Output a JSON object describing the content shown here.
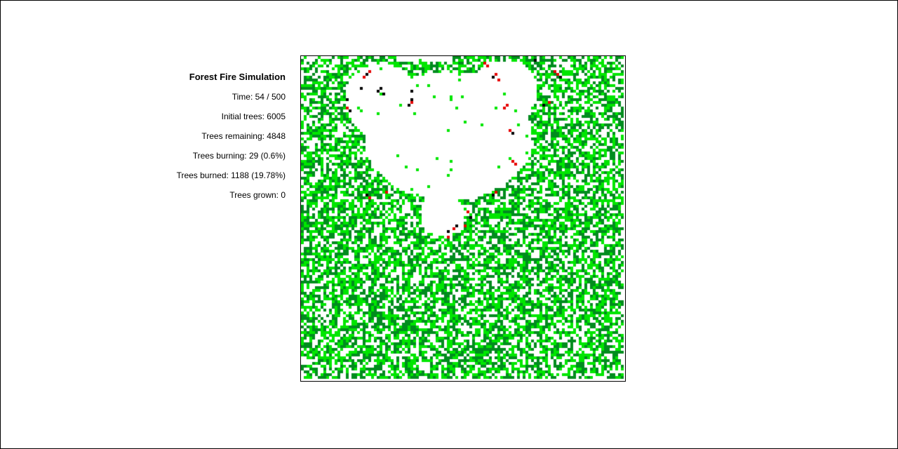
{
  "title": "Forest Fire Simulation",
  "stats": {
    "time_line": "Time: 54 / 500",
    "initial_trees_line": "Initial trees: 6005",
    "remaining_line": "Trees remaining: 4848",
    "burning_line": "Trees burning: 29 (0.6%)",
    "burned_line": "Trees burned: 1188 (19.78%)",
    "grown_line": "Trees grown: 0"
  },
  "simulation": {
    "time": 54,
    "max_time": 500,
    "initial_trees": 6005,
    "trees_remaining": 4848,
    "trees_burning": 29,
    "trees_burned": 1188,
    "trees_grown": 0
  },
  "colors": {
    "young_tree": "#00e600",
    "mature_tree": "#008c1e",
    "burning": "#e60000",
    "burnt": "#000000",
    "empty": "#ffffff"
  }
}
